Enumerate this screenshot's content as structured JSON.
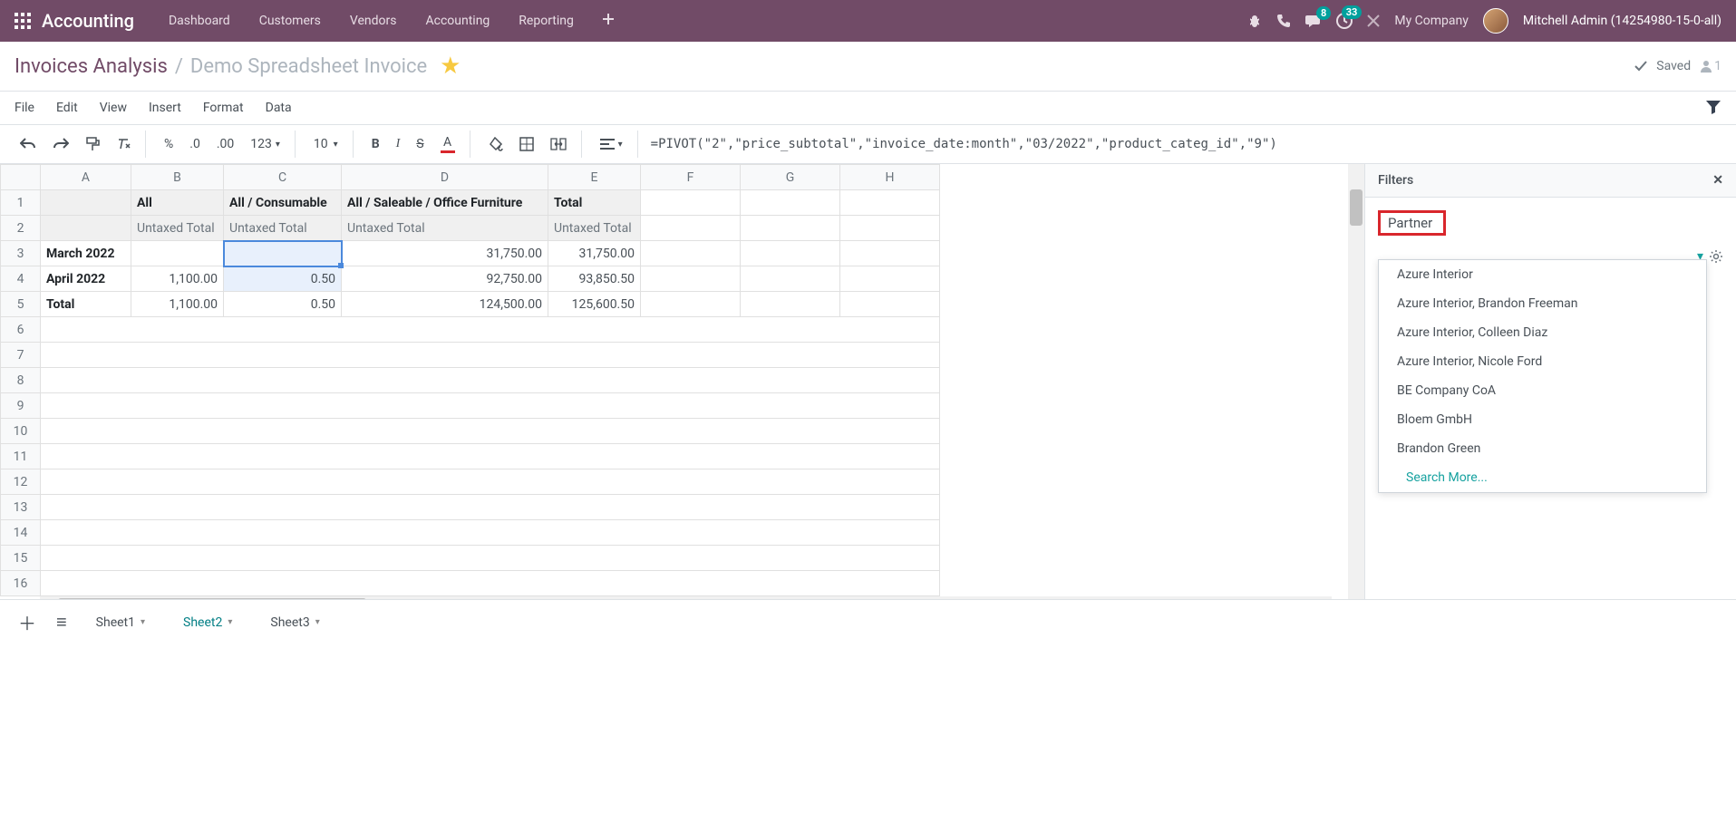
{
  "topnav": {
    "brand": "Accounting",
    "items": [
      "Dashboard",
      "Customers",
      "Vendors",
      "Accounting",
      "Reporting"
    ],
    "chat_badge": "8",
    "activity_badge": "33",
    "company": "My Company",
    "user": "Mitchell Admin (14254980-15-0-all)"
  },
  "breadcrumb": {
    "parent": "Invoices Analysis",
    "current": "Demo Spreadsheet Invoice",
    "saved": "Saved",
    "users": "1"
  },
  "menubar": [
    "File",
    "Edit",
    "View",
    "Insert",
    "Format",
    "Data"
  ],
  "toolbar": {
    "pct": "%",
    "dec0": ".0",
    "dec00": ".00",
    "num123": "123",
    "fontsize": "10",
    "formula": "=PIVOT(\"2\",\"price_subtotal\",\"invoice_date:month\",\"03/2022\",\"product_categ_id\",\"9\")"
  },
  "grid": {
    "col_headers": [
      "A",
      "B",
      "C",
      "D",
      "E",
      "F",
      "G",
      "H"
    ],
    "row1": {
      "B": "All",
      "C": "All / Consumable",
      "D": "All / Saleable / Office Furniture",
      "E": "Total"
    },
    "row2": {
      "B": "Untaxed Total",
      "C": "Untaxed Total",
      "D": "Untaxed Total",
      "E": "Untaxed Total"
    },
    "row3": {
      "A": "March 2022",
      "D": "31,750.00",
      "E": "31,750.00"
    },
    "row4": {
      "A": "April 2022",
      "B": "1,100.00",
      "C": "0.50",
      "D": "92,750.00",
      "E": "93,850.50"
    },
    "row5": {
      "A": "Total",
      "B": "1,100.00",
      "C": "0.50",
      "D": "124,500.00",
      "E": "125,600.50"
    }
  },
  "filters": {
    "title": "Filters",
    "partner_label": "Partner",
    "options": [
      "Azure Interior",
      "Azure Interior, Brandon Freeman",
      "Azure Interior, Colleen Diaz",
      "Azure Interior, Nicole Ford",
      "BE Company CoA",
      "Bloem GmbH",
      "Brandon Green"
    ],
    "search_more": "Search More..."
  },
  "tabs": {
    "list": [
      "Sheet1",
      "Sheet2",
      "Sheet3"
    ],
    "active": 1
  }
}
